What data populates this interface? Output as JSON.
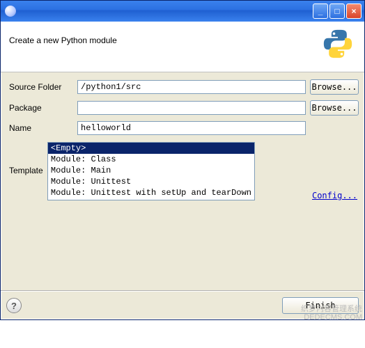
{
  "window": {
    "title_icon": "eclipse-icon",
    "controls": {
      "min": "_",
      "max": "□",
      "close": "×"
    }
  },
  "banner": {
    "title": "Create a new Python module",
    "logo": "python-logo"
  },
  "form": {
    "source_folder": {
      "label": "Source Folder",
      "value": "/python1/src",
      "browse": "Browse..."
    },
    "package": {
      "label": "Package",
      "value": "",
      "browse": "Browse..."
    },
    "name": {
      "label": "Name",
      "value": "helloworld"
    },
    "template": {
      "label": "Template",
      "config_link": "Config...",
      "selected_index": 0,
      "items": [
        "<Empty>",
        "Module: Class",
        "Module: Main",
        "Module: Unittest",
        "Module: Unittest with setUp and tearDown"
      ]
    }
  },
  "buttons": {
    "help": "?",
    "finish": "Finish"
  },
  "watermark": {
    "line1": "织梦内容管理系统",
    "line2": "DEDECMS.COM"
  }
}
